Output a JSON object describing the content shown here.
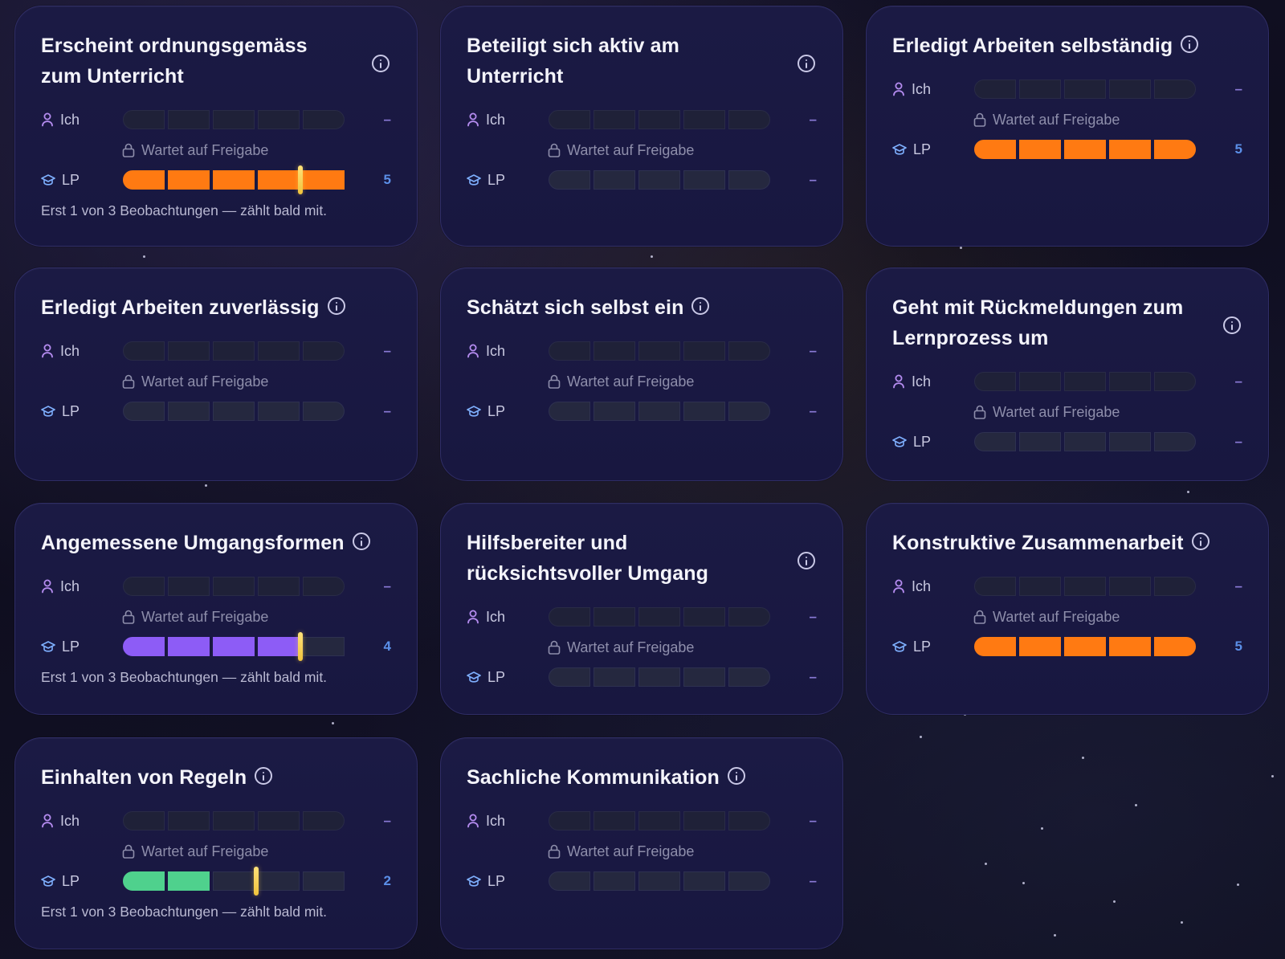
{
  "labels": {
    "self": "Ich",
    "teacher": "LP",
    "pending": "Wartet auf Freigabe",
    "note": "Erst 1 von 3 Beobachtungen — zählt bald mit.",
    "empty": "–"
  },
  "colors": {
    "orange": "#ff7a12",
    "purple": "#8d5cf6",
    "green": "#4fd18d",
    "marker": "#f5cd4b",
    "value_blue": "#5b8fe8",
    "dash": "#8a7ad6"
  },
  "scale_max": 5,
  "cards": [
    {
      "title": "Erscheint ordnungsgemäss zum Unterricht",
      "self_value": "–",
      "teacher_value": "5",
      "teacher_level": 5,
      "teacher_color": "orange",
      "marker_level": 4,
      "note": "Erst 1 von 3 Beobachtungen — zählt bald mit."
    },
    {
      "title": "Beteiligt sich aktiv am Unterricht",
      "self_value": "–",
      "teacher_value": "–",
      "teacher_level": 0
    },
    {
      "title": "Erledigt Arbeiten selbständig",
      "self_value": "–",
      "teacher_value": "5",
      "teacher_level": 5,
      "teacher_color": "orange"
    },
    {
      "title": "Erledigt Arbeiten zuverlässig",
      "self_value": "–",
      "teacher_value": "–",
      "teacher_level": 0
    },
    {
      "title": "Schätzt sich selbst ein",
      "self_value": "–",
      "teacher_value": "–",
      "teacher_level": 0
    },
    {
      "title": "Geht mit Rückmeldungen zum Lernprozess um",
      "self_value": "–",
      "teacher_value": "–",
      "teacher_level": 0
    },
    {
      "title": "Angemessene Umgangsformen",
      "self_value": "–",
      "teacher_value": "4",
      "teacher_level": 4,
      "teacher_color": "purple",
      "marker_level": 4,
      "note": "Erst 1 von 3 Beobachtungen — zählt bald mit."
    },
    {
      "title": "Hilfsbereiter und rücksichtsvoller Umgang",
      "self_value": "–",
      "teacher_value": "–",
      "teacher_level": 0
    },
    {
      "title": "Konstruktive Zusammenarbeit",
      "self_value": "–",
      "teacher_value": "5",
      "teacher_level": 5,
      "teacher_color": "orange"
    },
    {
      "title": "Einhalten von Regeln",
      "self_value": "–",
      "teacher_value": "2",
      "teacher_level": 2,
      "teacher_color": "green",
      "marker_level": 3,
      "note": "Erst 1 von 3 Beobachtungen — zählt bald mit."
    },
    {
      "title": "Sachliche Kommunikation",
      "self_value": "–",
      "teacher_value": "–",
      "teacher_level": 0
    }
  ]
}
